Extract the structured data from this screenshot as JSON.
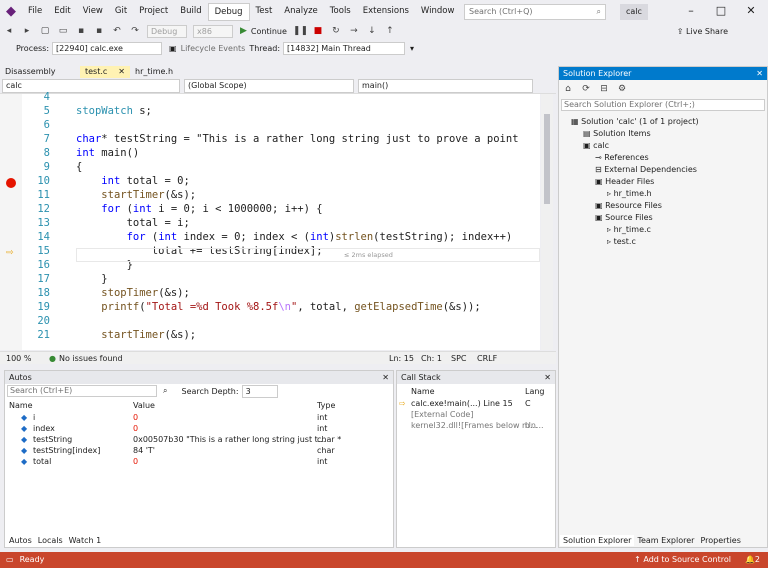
{
  "menu": {
    "items": [
      "File",
      "Edit",
      "View",
      "Git",
      "Project",
      "Build",
      "Debug",
      "Test",
      "Analyze",
      "Tools",
      "Extensions",
      "Window",
      "Help"
    ],
    "search_placeholder": "Search (Ctrl+Q)",
    "solution_badge": "calc",
    "live_share": "Live Share"
  },
  "toolbar": {
    "config": "Debug",
    "platform": "x86",
    "continue": "Continue"
  },
  "procbar": {
    "process_label": "Process:",
    "process": "[22940] calc.exe",
    "lifecycle": "Lifecycle Events",
    "thread_label": "Thread:",
    "thread": "[14832] Main Thread"
  },
  "tabs": [
    "Disassembly",
    "test.c",
    "hr_time.h"
  ],
  "editorbar": {
    "file": "calc",
    "scope": "(Global Scope)",
    "member": "main()"
  },
  "code": [
    {
      "n": "4",
      "t": ""
    },
    {
      "n": "5",
      "t": "stopWatch s;"
    },
    {
      "n": "6",
      "t": ""
    },
    {
      "n": "7",
      "t": "char* testString = \"This is a rather long string just to prove a point"
    },
    {
      "n": "8",
      "t": "int main()"
    },
    {
      "n": "9",
      "t": "{"
    },
    {
      "n": "10",
      "t": "    int total = 0;"
    },
    {
      "n": "11",
      "t": "    startTimer(&s);"
    },
    {
      "n": "12",
      "t": "    for (int i = 0; i < 1000000; i++) {"
    },
    {
      "n": "13",
      "t": "        total = i;"
    },
    {
      "n": "14",
      "t": "        for (int index = 0; index < (int)strlen(testString); index++)"
    },
    {
      "n": "15",
      "t": "            total += testString[index];"
    },
    {
      "n": "16",
      "t": "        }"
    },
    {
      "n": "17",
      "t": "    }"
    },
    {
      "n": "18",
      "t": "    stopTimer(&s);"
    },
    {
      "n": "19",
      "t": "    printf(\"Total =%d Took %8.5f\\n\", total, getElapsedTime(&s));"
    },
    {
      "n": "20",
      "t": ""
    },
    {
      "n": "21",
      "t": "    startTimer(&s);"
    }
  ],
  "elapsed_hint": "≤ 2ms elapsed",
  "editor_status": {
    "zoom": "100 %",
    "issues": "No issues found",
    "ln": "Ln: 15",
    "ch": "Ch: 1",
    "spc": "SPC",
    "crlf": "CRLF"
  },
  "solution": {
    "title": "Solution Explorer",
    "search": "Search Solution Explorer (Ctrl+;)",
    "items": [
      "Solution 'calc' (1 of 1 project)",
      "Solution Items",
      "calc",
      "References",
      "External Dependencies",
      "Header Files",
      "hr_time.h",
      "Resource Files",
      "Source Files",
      "hr_time.c",
      "test.c"
    ],
    "tabs": [
      "Solution Explorer",
      "Team Explorer",
      "Properties"
    ]
  },
  "autos": {
    "title": "Autos",
    "search": "Search (Ctrl+E)",
    "depth_label": "Search Depth:",
    "depth": "3",
    "headers": [
      "Name",
      "Value",
      "Type"
    ],
    "rows": [
      [
        "i",
        "0",
        "int"
      ],
      [
        "index",
        "0",
        "int"
      ],
      [
        "testString",
        "0x00507b30 \"This is a rather long string just t...",
        "char *"
      ],
      [
        "testString[index]",
        "84 'T'",
        "char"
      ],
      [
        "total",
        "0",
        "int"
      ]
    ],
    "tabs": [
      "Autos",
      "Locals",
      "Watch 1"
    ]
  },
  "callstack": {
    "title": "Call Stack",
    "headers": [
      "Name",
      "Lang"
    ],
    "rows": [
      [
        "calc.exe!main(...) Line 15",
        "C"
      ],
      [
        "[External Code]",
        ""
      ],
      [
        "kernel32.dll![Frames below m...",
        "Un..."
      ]
    ]
  },
  "status": {
    "ready": "Ready",
    "source_control": "Add to Source Control",
    "notifications": "2"
  }
}
